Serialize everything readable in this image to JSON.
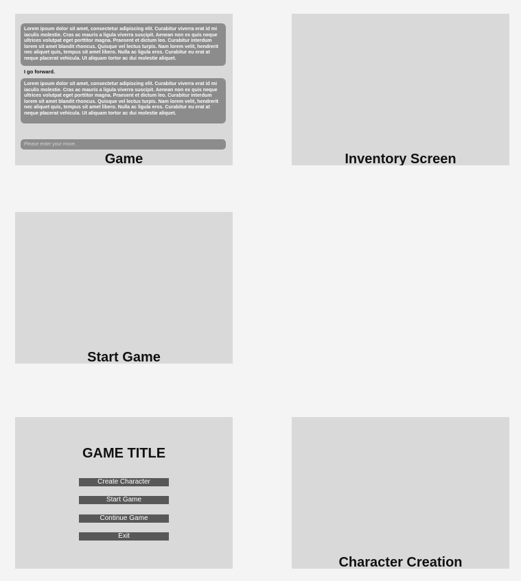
{
  "game": {
    "title": "Game",
    "messages": [
      "Lorem ipsum dolor sit amet, consectetur adipiscing elit. Curabitur viverra erat id mi iaculis molestie. Cras ac mauris a ligula viverra suscipit. Aenean non ex quis neque ultrices volutpat eget porttitor magna. Praesent et dictum leo. Curabitur interdum lorem sit amet blandit rhoncus. Quisque vel lectus turpis. Nam lorem velit, hendrerit nec aliquet quis, tempus sit amet libero. Nulla ac ligula eros. Curabitur eu erat at neque placerat vehicula. Ut aliquam tortor ac dui molestie aliquet.",
      "Lorem ipsum dolor sit amet, consectetur adipiscing elit. Curabitur viverra erat id mi iaculis molestie. Cras ac mauris a ligula viverra suscipit. Aenean non ex quis neque ultrices volutpat eget porttitor magna. Praesent et dictum leo. Curabitur interdum lorem sit amet blandit rhoncus. Quisque vel lectus turpis. Nam lorem velit, hendrerit nec aliquet quis, tempus sit amet libero. Nulla ac ligula eros. Curabitur eu erat at neque placerat vehicula. Ut aliquam tortor ac dui molestie aliquet."
    ],
    "player_line": "I go forward.",
    "input_placeholder": "Please enter your move."
  },
  "inventory": {
    "title": "Inventory Screen"
  },
  "start_game": {
    "title": "Start Game"
  },
  "main_menu": {
    "title": "GAME TITLE",
    "buttons": [
      "Create Character",
      "Start Game",
      "Continue Game",
      "Exit"
    ]
  },
  "character_creation": {
    "title": "Character Creation"
  },
  "colors": {
    "page_background": "#f4f4f4",
    "frame_background": "#d9d9d9",
    "message_background": "#8c8c8c",
    "button_background": "#585858"
  }
}
